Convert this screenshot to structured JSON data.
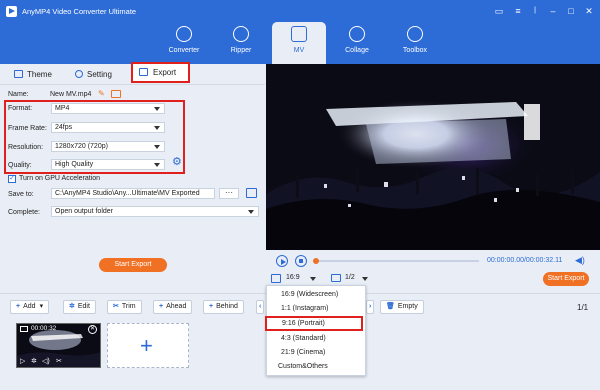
{
  "app": {
    "title": "AnyMP4 Video Converter Ultimate"
  },
  "nav": [
    {
      "label": "Converter",
      "icon": "converter-icon"
    },
    {
      "label": "Ripper",
      "icon": "ripper-icon"
    },
    {
      "label": "MV",
      "icon": "mv-icon",
      "active": true
    },
    {
      "label": "Collage",
      "icon": "collage-icon"
    },
    {
      "label": "Toolbox",
      "icon": "toolbox-icon"
    }
  ],
  "tabs": {
    "theme": "Theme",
    "setting": "Setting",
    "export": "Export"
  },
  "export": {
    "name_label": "Name:",
    "name_value": "New MV.mp4",
    "format_label": "Format:",
    "format_value": "MP4",
    "framerate_label": "Frame Rate:",
    "framerate_value": "24fps",
    "resolution_label": "Resolution:",
    "resolution_value": "1280x720 (720p)",
    "quality_label": "Quality:",
    "quality_value": "High Quality",
    "gpu_label": "Turn on GPU Acceleration",
    "saveto_label": "Save to:",
    "saveto_value": "C:\\AnyMP4 Studio\\Any...Ultimate\\MV Exported",
    "browse_label": "···",
    "complete_label": "Complete:",
    "complete_value": "Open output folder",
    "start_export": "Start Export"
  },
  "player": {
    "time": "00:00:00.00/00:00:32.11",
    "aspect": "16:9",
    "page": "1/2",
    "start_export": "Start Export"
  },
  "aspect_options": [
    "16:9 (Widescreen)",
    "1:1 (Instagram)",
    "9:16 (Portrait)",
    "4:3 (Standard)",
    "21:9 (Cinema)",
    "Custom&Others"
  ],
  "toolbar": {
    "add": "Add",
    "edit": "Edit",
    "trim": "Trim",
    "ahead": "Ahead",
    "behind": "Behind",
    "empty": "Empty",
    "page_count": "1/1"
  },
  "timeline": {
    "clip_time": "00:00:32"
  },
  "colors": {
    "brand": "#2d6bd6",
    "accent": "#f07024",
    "highlight": "#e0201c"
  }
}
